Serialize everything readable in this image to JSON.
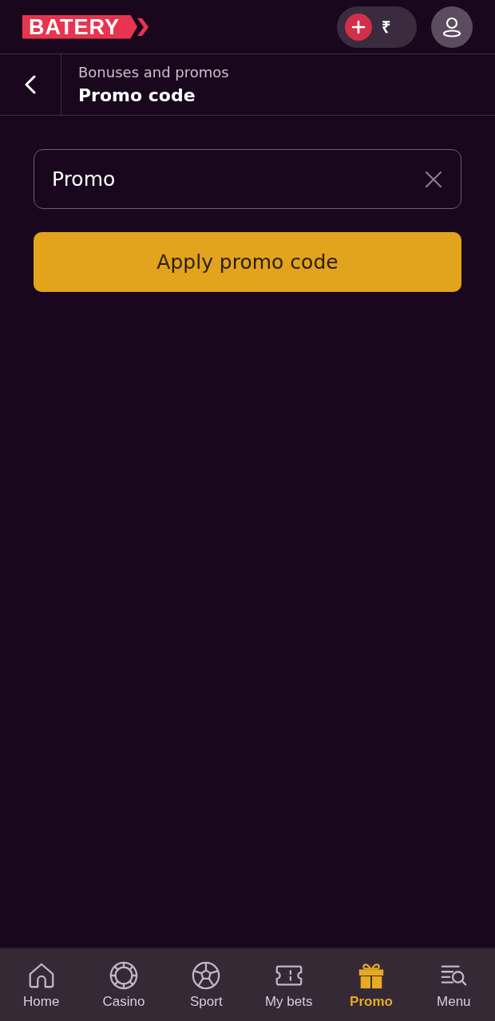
{
  "header": {
    "logo": "BATERY",
    "currency": "₹"
  },
  "breadcrumb": {
    "parent": "Bonuses and promos",
    "title": "Promo code"
  },
  "promo_field": {
    "value": "Promo"
  },
  "apply_button": "Apply promo code",
  "nav": [
    {
      "kind": "home",
      "label": "Home",
      "selected": false
    },
    {
      "kind": "casino",
      "label": "Casino",
      "selected": false
    },
    {
      "kind": "sport",
      "label": "Sport",
      "selected": false
    },
    {
      "kind": "bets",
      "label": "My bets",
      "selected": false
    },
    {
      "kind": "promo",
      "label": "Promo",
      "selected": true
    },
    {
      "kind": "menu",
      "label": "Menu",
      "selected": false
    }
  ]
}
